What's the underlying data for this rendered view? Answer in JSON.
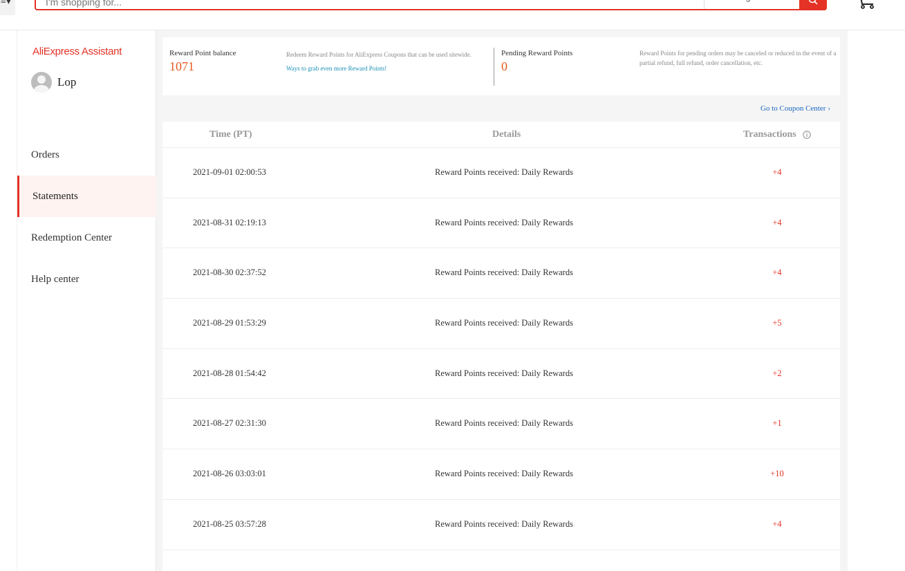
{
  "header": {
    "menu_glyph": "≡▾",
    "search_placeholder": "I'm shopping for...",
    "category_selected": "All Categories",
    "icons": {
      "search": "search-icon",
      "cart": "cart-icon"
    }
  },
  "sidebar": {
    "brand_ali": "AliExpress",
    "brand_assistant": " Assistant",
    "username": "Lop",
    "items": [
      {
        "label": "Orders",
        "active": false
      },
      {
        "label": "Statements",
        "active": true
      },
      {
        "label": "Redemption Center",
        "active": false
      },
      {
        "label": "Help center",
        "active": false
      }
    ]
  },
  "summary": {
    "balance_label": "Reward Point balance",
    "balance_value": "1071",
    "redeem_text": "Redeem Reward Points for AliExpress Coupons that can be used sitewide.",
    "ways_link": "Ways to grab even more Reward Points!",
    "pending_label": "Pending Reward Points",
    "pending_value": "0",
    "pending_note": "Reward Points for pending orders may be canceled or reduced in the event of a partial refund, full refund, order cancellation, etc."
  },
  "coupon_link": {
    "label": "Go to Coupon Center",
    "chevron": "›"
  },
  "table": {
    "headers": {
      "time": "Time (PT)",
      "details": "Details",
      "transactions": "Transactions"
    },
    "rows": [
      {
        "time": "2021-09-01 02:00:53",
        "details": "Reward Points received: Daily Rewards",
        "amount": "+4"
      },
      {
        "time": "2021-08-31 02:19:13",
        "details": "Reward Points received: Daily Rewards",
        "amount": "+4"
      },
      {
        "time": "2021-08-30 02:37:52",
        "details": "Reward Points received: Daily Rewards",
        "amount": "+4"
      },
      {
        "time": "2021-08-29 01:53:29",
        "details": "Reward Points received: Daily Rewards",
        "amount": "+5"
      },
      {
        "time": "2021-08-28 01:54:42",
        "details": "Reward Points received: Daily Rewards",
        "amount": "+2"
      },
      {
        "time": "2021-08-27 02:31:30",
        "details": "Reward Points received: Daily Rewards",
        "amount": "+1"
      },
      {
        "time": "2021-08-26 03:03:01",
        "details": "Reward Points received: Daily Rewards",
        "amount": "+10"
      },
      {
        "time": "2021-08-25 03:57:28",
        "details": "Reward Points received: Daily Rewards",
        "amount": "+4"
      }
    ]
  },
  "colors": {
    "accent": "#e43226",
    "points": "#e65a1c",
    "link": "#1565c0"
  }
}
